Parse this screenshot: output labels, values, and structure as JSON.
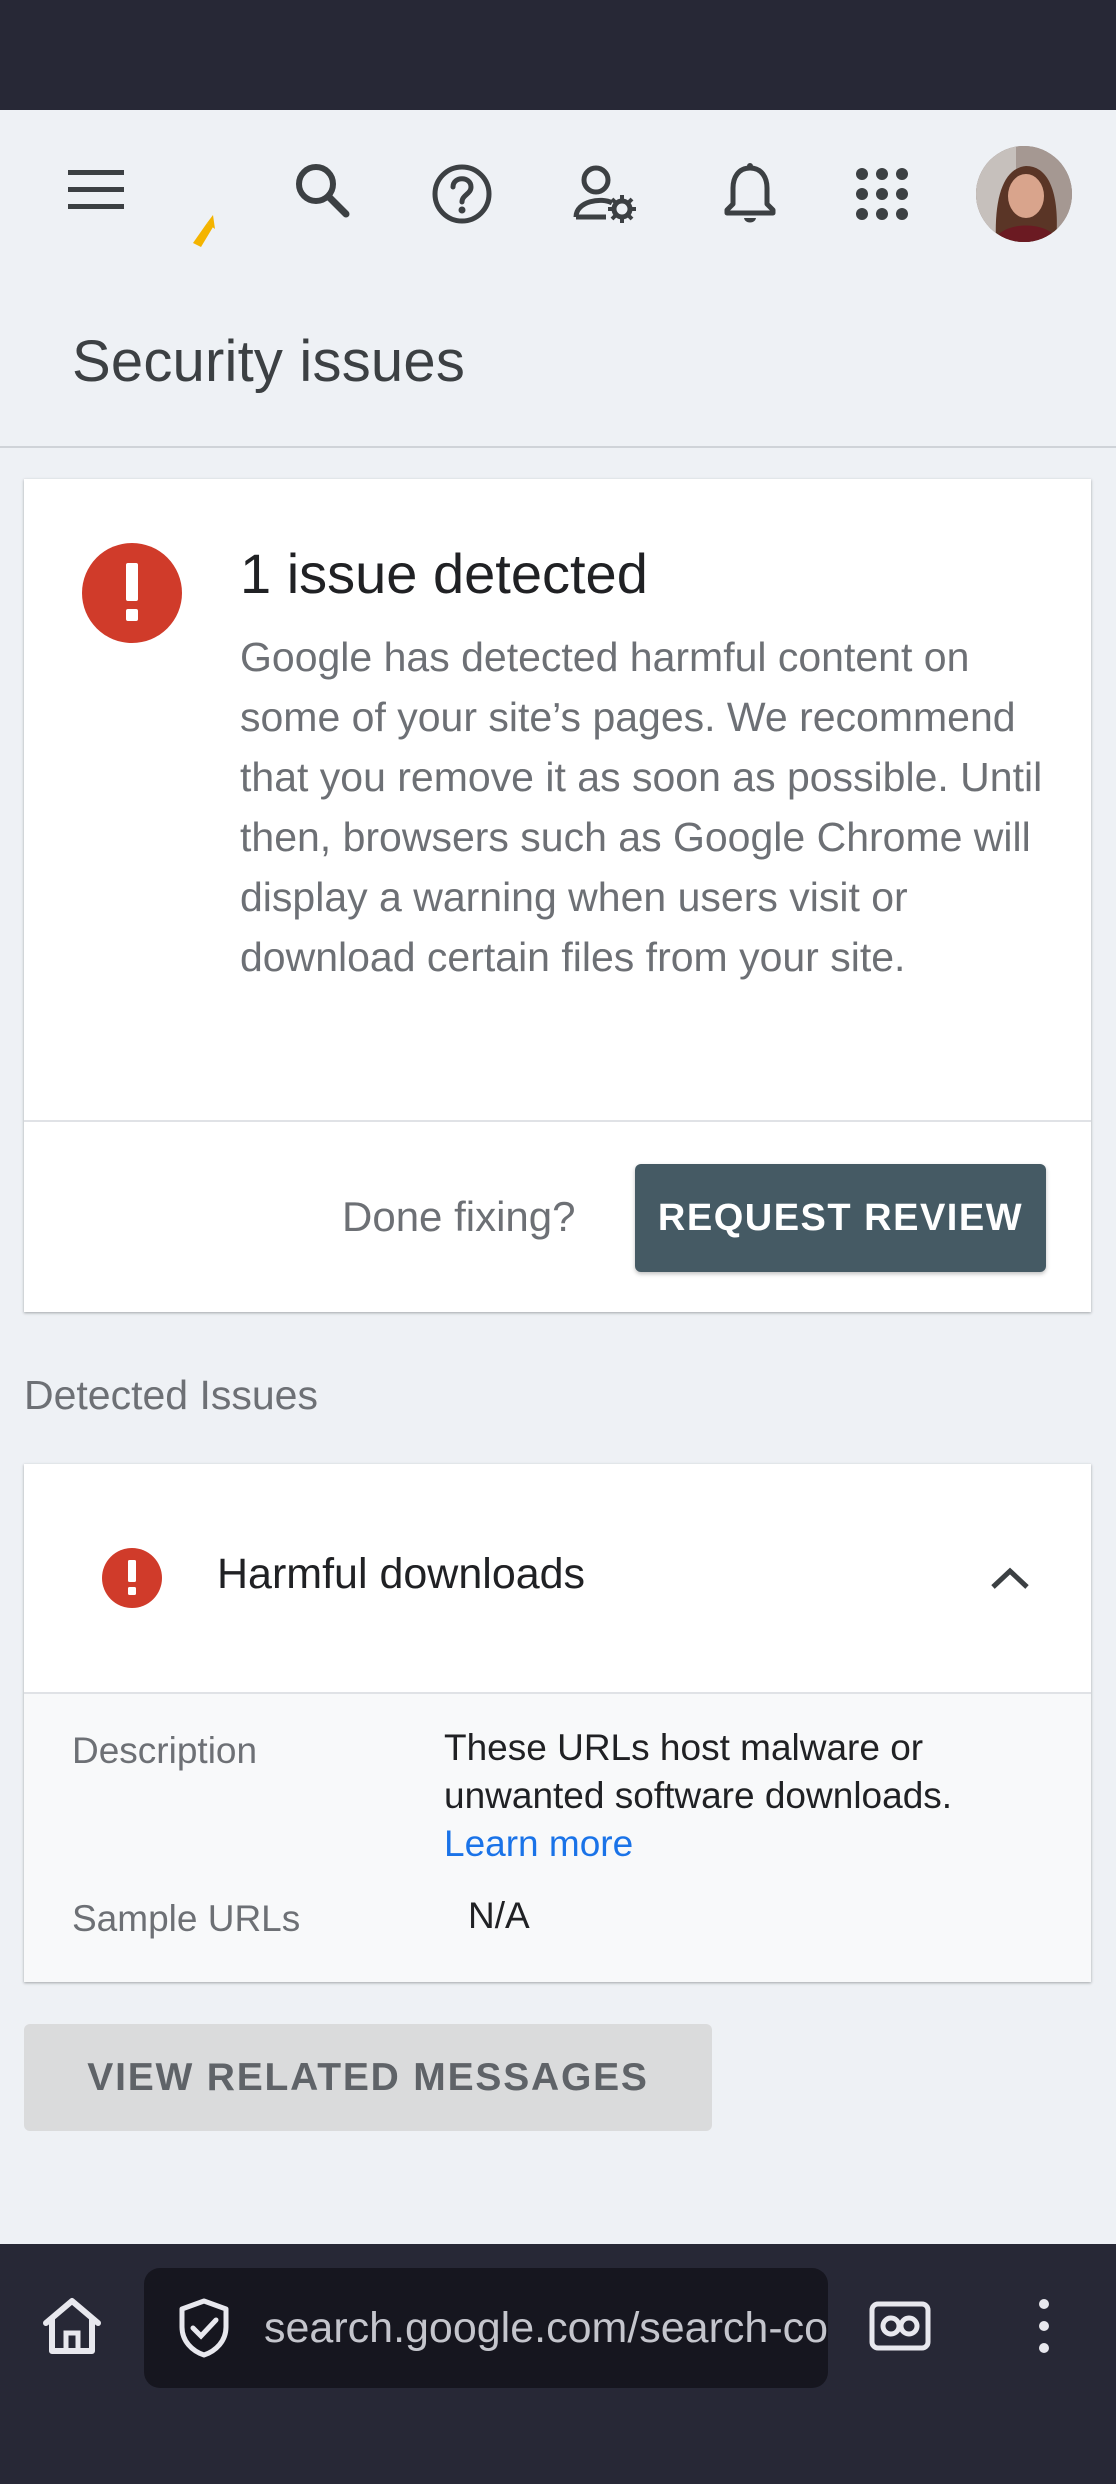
{
  "header": {
    "icons": [
      "menu-icon",
      "search-console-logo",
      "search-icon",
      "help-icon",
      "manage-users-icon",
      "notifications-icon",
      "apps-grid-icon",
      "account-avatar"
    ]
  },
  "page": {
    "title": "Security issues"
  },
  "issue_card": {
    "title": "1 issue detected",
    "body": "Google has detected harmful content on some of your site’s pages. We recommend that you remove it as soon as possible. Until then, browsers such as Google Chrome will display a warning when users visit or download certain files from your site.",
    "done_label": "Done fixing?",
    "review_button": "REQUEST REVIEW"
  },
  "detected": {
    "section_label": "Detected Issues",
    "item": {
      "title": "Harmful downloads",
      "description_label": "Description",
      "description_value": "These URLs host malware or unwanted software downloads.",
      "learn_more": "Learn more",
      "sample_label": "Sample URLs",
      "sample_value": "N/A"
    }
  },
  "related_button": "VIEW RELATED MESSAGES",
  "browser": {
    "url": "search.google.com/search-console"
  },
  "colors": {
    "alert": "#d03b2a",
    "button_primary": "#455a64",
    "link": "#1a73e8",
    "logo_accent": "#f4b400",
    "system_bar": "#272836"
  }
}
